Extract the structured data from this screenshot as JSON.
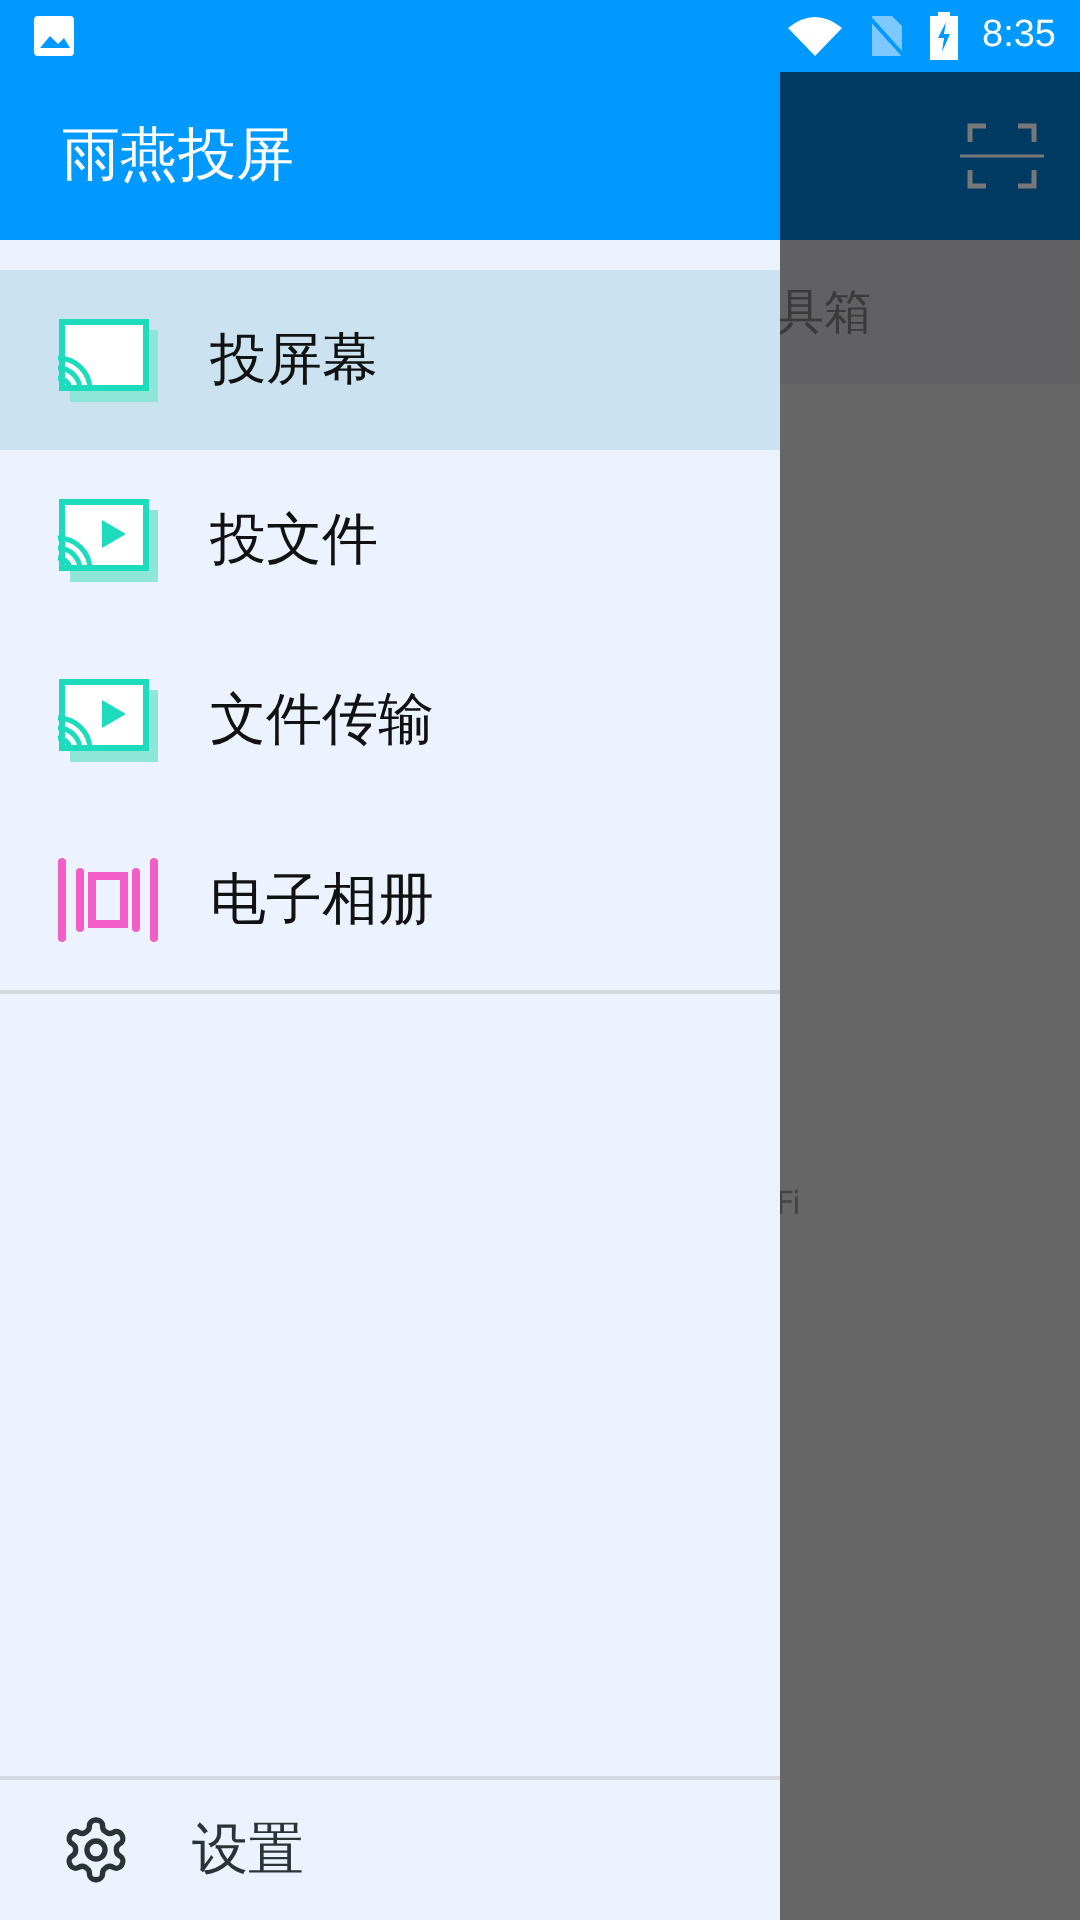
{
  "status_bar": {
    "time": "8:35"
  },
  "background_app": {
    "tab_label": "具箱",
    "hint_text": "Fi"
  },
  "drawer": {
    "title": "雨燕投屏",
    "items": [
      {
        "label": "投屏幕",
        "kind": "cast",
        "selected": true
      },
      {
        "label": "投文件",
        "kind": "cast-play",
        "selected": false
      },
      {
        "label": "文件传输",
        "kind": "cast-play",
        "selected": false
      },
      {
        "label": "电子相册",
        "kind": "album",
        "selected": false
      }
    ],
    "footer": {
      "label": "设置"
    }
  }
}
